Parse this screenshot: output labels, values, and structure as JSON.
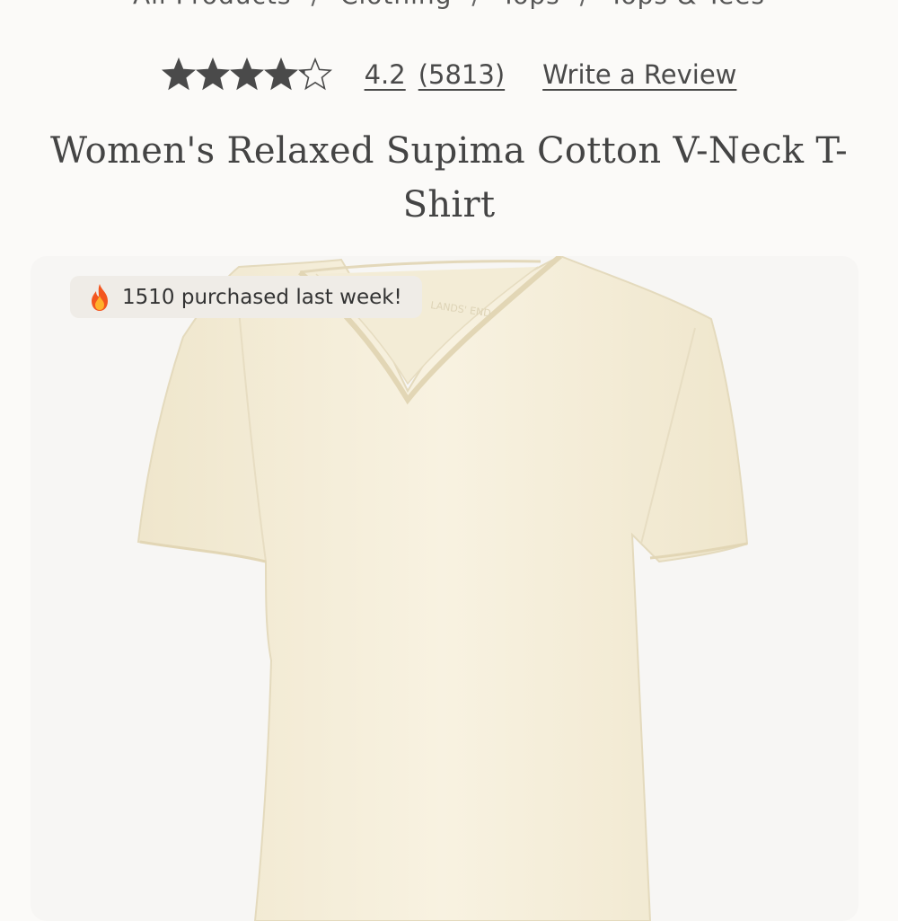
{
  "breadcrumb": [
    "All Products",
    "Clothing",
    "Tops",
    "Tops & Tees"
  ],
  "breadcrumb_separator": "/",
  "rating": {
    "value": "4.2",
    "count": "(5813)",
    "stars_filled": 4.2,
    "stars_total": 5,
    "write_review": "Write a Review"
  },
  "product": {
    "title": "Women's Relaxed Supima Cotton V-Neck T-Shirt",
    "badge_text": "1510 purchased last week!",
    "badge_icon": "fire-icon",
    "shirt_color": "#f6f0dd",
    "shirt_brand_tag": "LANDS' END"
  },
  "colors": {
    "star_fill": "#4a4a4a",
    "background": "#fbfaf8"
  }
}
